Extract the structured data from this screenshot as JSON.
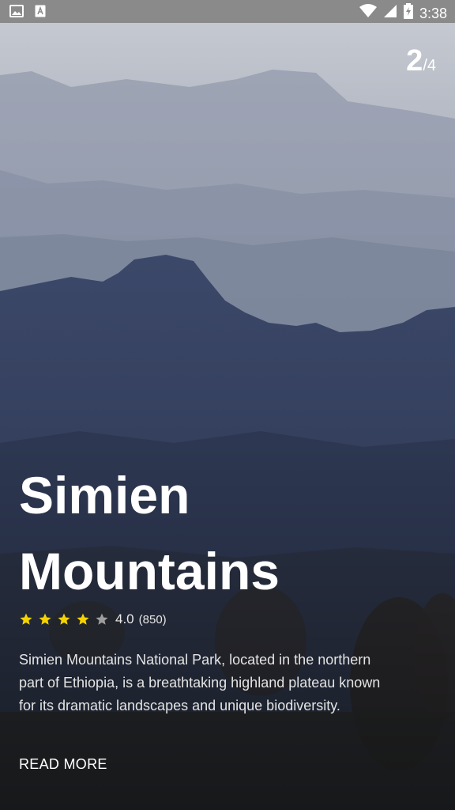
{
  "status_bar": {
    "time": "3:38",
    "left_icons": [
      "image-icon",
      "text-a-icon"
    ],
    "right_icons": [
      "wifi-icon",
      "cell-signal-icon",
      "battery-charging-icon"
    ]
  },
  "pager": {
    "current": "2",
    "separator": "/",
    "total": "4"
  },
  "destination": {
    "title": "Simien Mountains",
    "rating": {
      "value": "4.0",
      "count": "(850)",
      "stars_filled": 4,
      "stars_total": 5
    },
    "description": "Simien Mountains National Park, located in the northern part of Ethiopia, is a breathtaking highland plateau known for its dramatic landscapes and unique biodiversity.",
    "read_more_label": "READ MORE"
  },
  "colors": {
    "star_filled": "#f5d300",
    "star_empty": "#9e9e9e",
    "status_bar": "#8a8a8a"
  }
}
